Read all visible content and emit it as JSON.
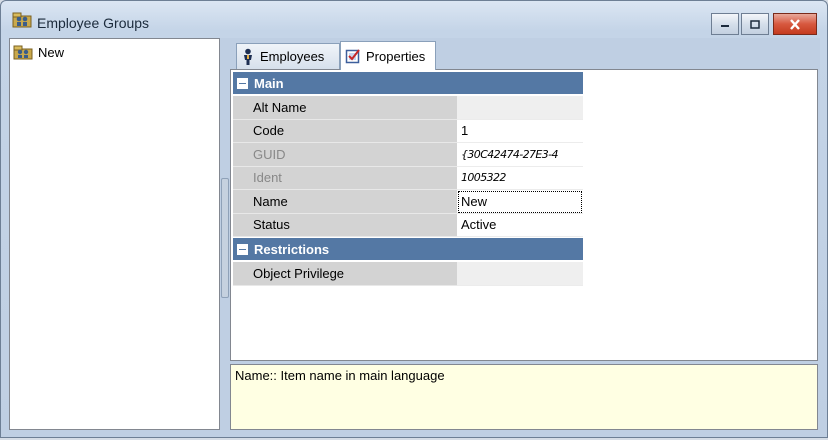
{
  "window": {
    "title": "Employee Groups"
  },
  "caption": {
    "minimize_icon": "minimize-icon",
    "maximize_icon": "maximize-icon",
    "close_icon": "close-icon"
  },
  "tree": {
    "items": [
      {
        "label": "New",
        "icon": "group-folder-icon"
      }
    ]
  },
  "tabs": [
    {
      "label": "Employees",
      "icon": "person-icon",
      "active": false
    },
    {
      "label": "Properties",
      "icon": "checkbox-icon",
      "active": true
    }
  ],
  "properties": {
    "main": {
      "title": "Main",
      "rows": [
        {
          "key": "Alt Name",
          "value": ""
        },
        {
          "key": "Code",
          "value": "1"
        },
        {
          "key": "GUID",
          "value": "{30C42474-27E3-4"
        },
        {
          "key": "Ident",
          "value": "1005322"
        },
        {
          "key": "Name",
          "value": "New"
        },
        {
          "key": "Status",
          "value": "Active"
        }
      ]
    },
    "restrictions": {
      "title": "Restrictions",
      "rows": [
        {
          "key": "Object Privilege",
          "value": ""
        }
      ]
    }
  },
  "help": {
    "text": "Name:: Item name in main language"
  },
  "colors": {
    "category_header": "#5478a4",
    "help_background": "#ffffe3"
  }
}
